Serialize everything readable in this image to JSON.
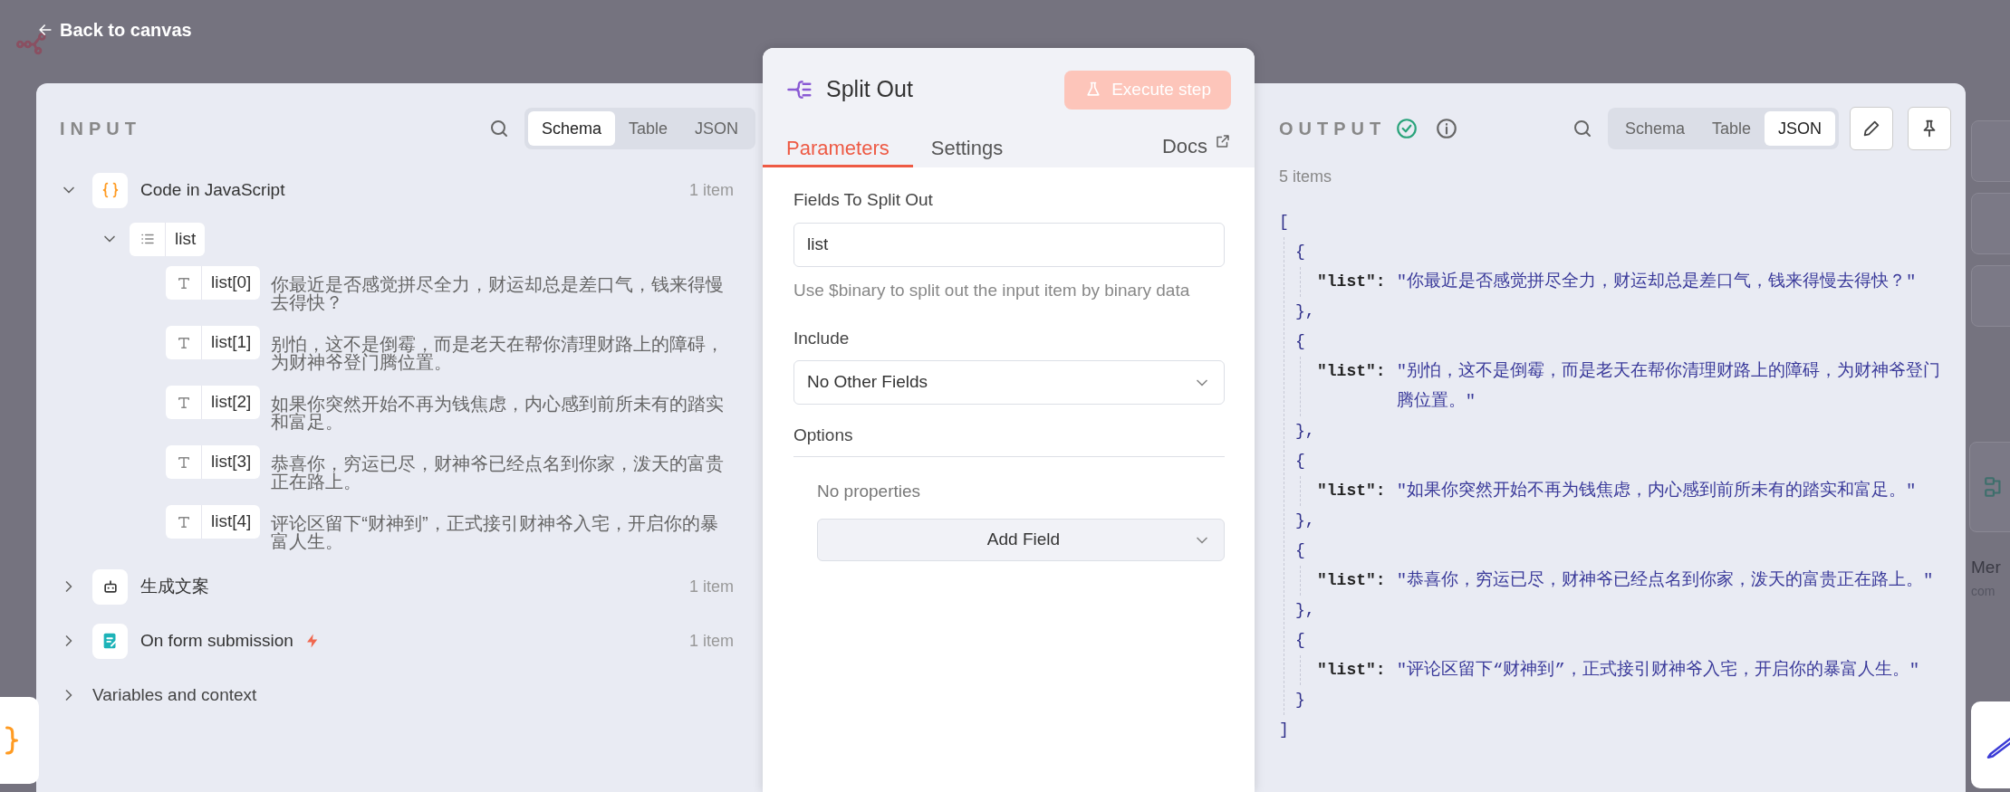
{
  "top_bar": {
    "back_label": "Back to canvas"
  },
  "input_panel": {
    "title": "INPUT",
    "view_tabs": [
      {
        "label": "Schema",
        "selected": true
      },
      {
        "label": "Table",
        "selected": false
      },
      {
        "label": "JSON",
        "selected": false
      }
    ],
    "nodes": [
      {
        "kind": "code",
        "label": "Code in JavaScript",
        "count": "1 item",
        "expanded": true,
        "trigger": false,
        "children": [
          {
            "kind": "array",
            "label": "list",
            "expanded": true,
            "children": [
              {
                "kind": "string",
                "label": "list[0]",
                "value": "你最近是否感觉拼尽全力，财运却总是差口气，钱来得慢去得快？"
              },
              {
                "kind": "string",
                "label": "list[1]",
                "value": "别怕，这不是倒霉，而是老天在帮你清理财路上的障碍，为财神爷登门腾位置。"
              },
              {
                "kind": "string",
                "label": "list[2]",
                "value": "如果你突然开始不再为钱焦虑，内心感到前所未有的踏实和富足。"
              },
              {
                "kind": "string",
                "label": "list[3]",
                "value": "恭喜你，穷运已尽，财神爷已经点名到你家，泼天的富贵正在路上。"
              },
              {
                "kind": "string",
                "label": "list[4]",
                "value": "评论区留下“财神到”，正式接引财神爷入宅，开启你的暴富人生。"
              }
            ]
          }
        ]
      },
      {
        "kind": "ai",
        "label": "生成文案",
        "count": "1 item",
        "expanded": false,
        "trigger": false
      },
      {
        "kind": "form",
        "label": "On form submission",
        "count": "1 item",
        "expanded": false,
        "trigger": true
      }
    ],
    "variables": {
      "label": "Variables and context",
      "expanded": false
    }
  },
  "node_panel": {
    "title": "Split Out",
    "execute_label": "Execute step",
    "execute_disabled": true,
    "tabs": [
      {
        "label": "Parameters",
        "selected": true
      },
      {
        "label": "Settings",
        "selected": false
      }
    ],
    "docs_label": "Docs",
    "fields_label": "Fields To Split Out",
    "fields_value": "list",
    "fields_hint": "Use $binary to split out the input item by binary data",
    "include_label": "Include",
    "include_value": "No Other Fields",
    "options_label": "Options",
    "options_empty": "No properties",
    "add_field_label": "Add Field"
  },
  "output_panel": {
    "title": "OUTPUT",
    "success": true,
    "view_tabs": [
      {
        "label": "Schema",
        "selected": false
      },
      {
        "label": "Table",
        "selected": false
      },
      {
        "label": "JSON",
        "selected": true
      }
    ],
    "count": "5 items",
    "json_view": {
      "open": "[",
      "close": "]",
      "items": [
        {
          "open": "{",
          "key": "\"list\":",
          "value": "\"你最近是否感觉拼尽全力，财运却总是差口气，钱来得慢去得快？\"",
          "close": "},"
        },
        {
          "open": "{",
          "key": "\"list\":",
          "value": "\"别怕，这不是倒霉，而是老天在帮你清理财路上的障碍，为财神爷登门腾位置。\"",
          "close": "},"
        },
        {
          "open": "{",
          "key": "\"list\":",
          "value": "\"如果你突然开始不再为钱焦虑，内心感到前所未有的踏实和富足。\"",
          "close": "},"
        },
        {
          "open": "{",
          "key": "\"list\":",
          "value": "\"恭喜你，穷运已尽，财神爷已经点名到你家，泼天的富贵正在路上。\"",
          "close": "},"
        },
        {
          "open": "{",
          "key": "\"list\":",
          "value": "\"评论区留下“财神到”，正式接引财神爷入宅，开启你的暴富人生。\"",
          "close": "}"
        }
      ]
    }
  },
  "canvas": {
    "node_label": "Mer",
    "node_sublabel": "com"
  }
}
